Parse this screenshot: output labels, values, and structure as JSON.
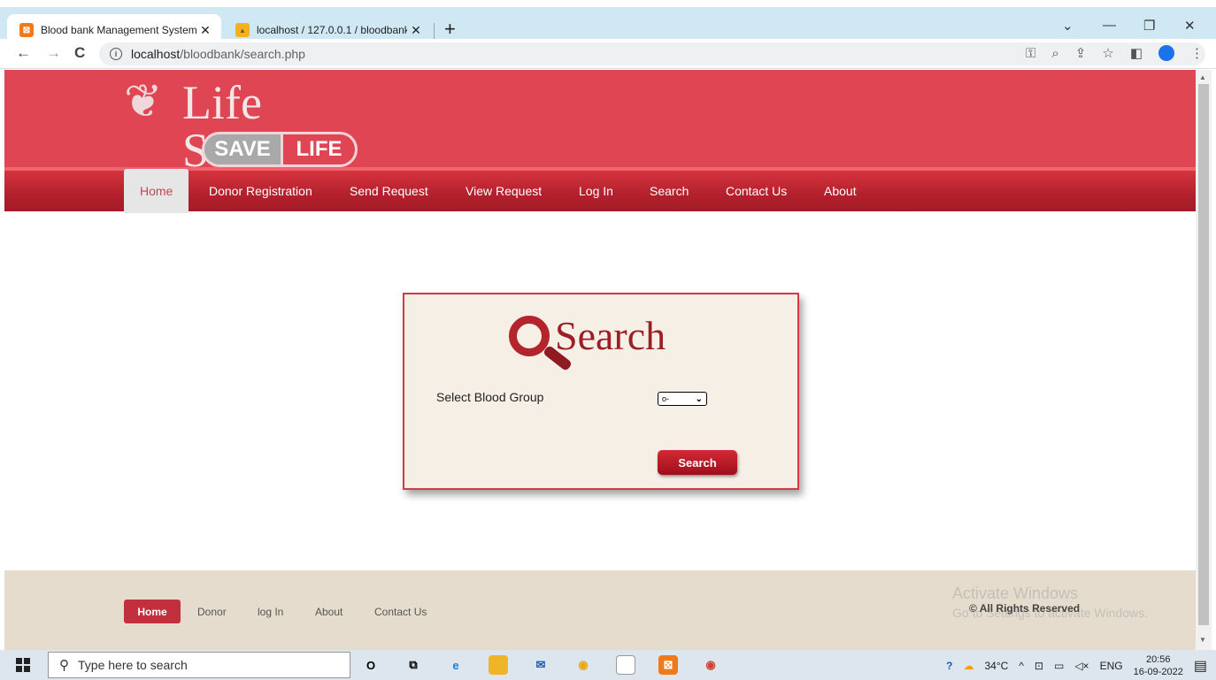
{
  "browser": {
    "tabs": [
      {
        "title": "Blood bank Management System",
        "close": "✕",
        "active": true
      },
      {
        "title": "localhost / 127.0.0.1 / bloodbank",
        "close": "✕",
        "active": false
      }
    ],
    "new_tab": "+",
    "url_host": "localhost",
    "url_path": "/bloodbank/search.php"
  },
  "header": {
    "logo_title": "Life Saver",
    "logo_save": "SAVE",
    "logo_life": "LIFE"
  },
  "nav": {
    "items": [
      {
        "label": "Home",
        "active": true
      },
      {
        "label": "Donor Registration"
      },
      {
        "label": "Send Request"
      },
      {
        "label": "View Request"
      },
      {
        "label": "Log In"
      },
      {
        "label": "Search"
      },
      {
        "label": "Contact Us"
      },
      {
        "label": "About"
      }
    ]
  },
  "search_panel": {
    "title": "Search",
    "blood_group_label": "Select Blood Group",
    "blood_group_selected": "o-",
    "button_label": "Search"
  },
  "footer": {
    "items": [
      {
        "label": "Home",
        "active": true
      },
      {
        "label": "Donor"
      },
      {
        "label": "log In"
      },
      {
        "label": "About"
      },
      {
        "label": "Contact Us"
      }
    ],
    "copyright": "© All Rights Reserved",
    "watermark_line1": "Activate Windows",
    "watermark_line2": "Go to Settings to activate Windows."
  },
  "taskbar": {
    "search_placeholder": "Type here to search",
    "temperature": "34°C",
    "language": "ENG",
    "time": "20:56",
    "date": "16-09-2022"
  },
  "colors": {
    "banner": "#e04553",
    "nav": "#b2202c",
    "panel_bg": "#f6efe6",
    "accent": "#9c1f28",
    "footer_bg": "#e6dccd"
  }
}
